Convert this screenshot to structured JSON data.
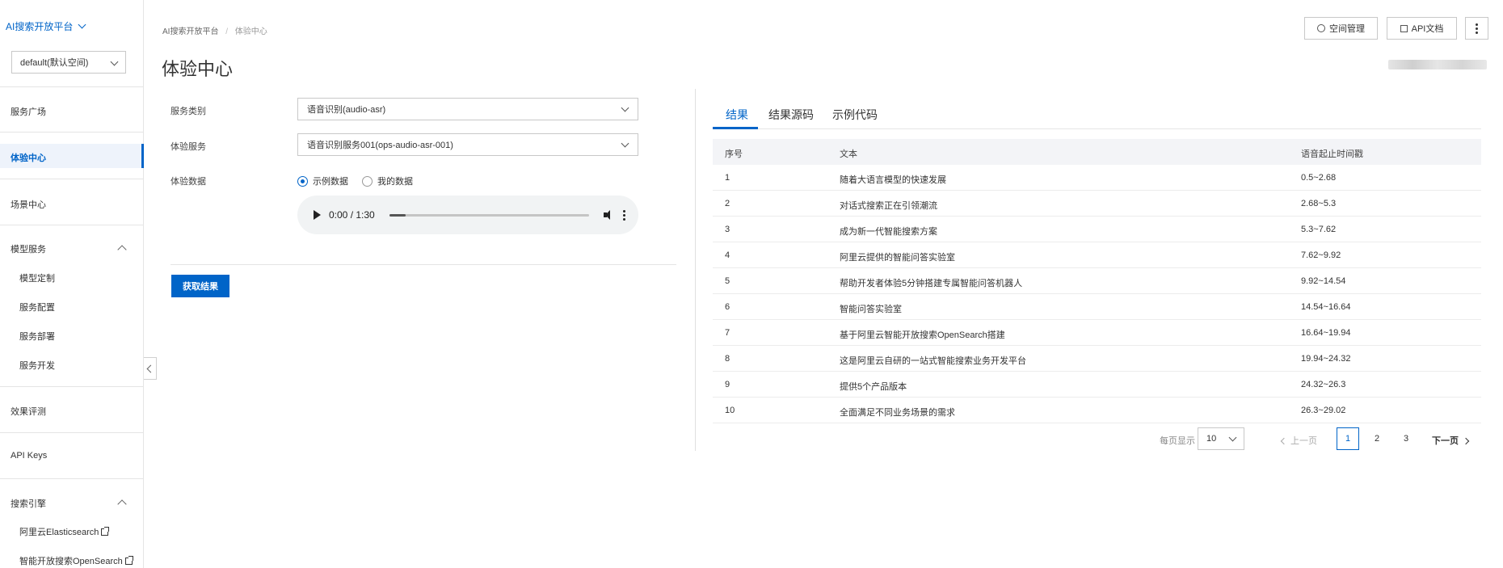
{
  "sidebar": {
    "brand": "AI搜索开放平台",
    "workspace": "default(默认空间)",
    "items": {
      "service_square": "服务广场",
      "experience_center": "体验中心",
      "scene_center": "场景中心",
      "model_service": "模型服务",
      "model_custom": "模型定制",
      "service_config": "服务配置",
      "service_deploy": "服务部署",
      "service_dev": "服务开发",
      "evaluation": "效果评测",
      "api_keys": "API Keys",
      "search_engine": "搜索引擎",
      "aliyun_es": "阿里云Elasticsearch",
      "opensearch": "智能开放搜索OpenSearch"
    }
  },
  "header": {
    "breadcrumb_root": "AI搜索开放平台",
    "breadcrumb_sep": "/",
    "breadcrumb_current": "体验中心",
    "title": "体验中心",
    "space_mgmt": "空间管理",
    "api_docs": "API文档"
  },
  "form": {
    "service_type_label": "服务类别",
    "service_type_value": "语音识别(audio-asr)",
    "service_label": "体验服务",
    "service_value": "语音识别服务001(ops-audio-asr-001)",
    "data_label": "体验数据",
    "radio_sample": "示例数据",
    "radio_mine": "我的数据",
    "audio_time": "0:00 / 1:30",
    "audio_progress": 0.0,
    "submit": "获取结果"
  },
  "results": {
    "tabs": [
      "结果",
      "结果源码",
      "示例代码"
    ],
    "columns": [
      "序号",
      "文本",
      "语音起止时间戳"
    ],
    "rows": [
      [
        "1",
        "随着大语言模型的快速发展",
        "0.5~2.68"
      ],
      [
        "2",
        "对话式搜索正在引领潮流",
        "2.68~5.3"
      ],
      [
        "3",
        "成为新一代智能搜索方案",
        "5.3~7.62"
      ],
      [
        "4",
        "阿里云提供的智能问答实验室",
        "7.62~9.92"
      ],
      [
        "5",
        "帮助开发者体验5分钟搭建专属智能问答机器人",
        "9.92~14.54"
      ],
      [
        "6",
        "智能问答实验室",
        "14.54~16.64"
      ],
      [
        "7",
        "基于阿里云智能开放搜索OpenSearch搭建",
        "16.64~19.94"
      ],
      [
        "8",
        "这是阿里云自研的一站式智能搜索业务开发平台",
        "19.94~24.32"
      ],
      [
        "9",
        "提供5个产品版本",
        "24.32~26.3"
      ],
      [
        "10",
        "全面满足不同业务场景的需求",
        "26.3~29.02"
      ]
    ]
  },
  "pagination": {
    "per_page_label": "每页显示",
    "per_page": "10",
    "prev": "上一页",
    "pages": [
      "1",
      "2",
      "3"
    ],
    "next": "下一页"
  },
  "colors": {
    "accent": "#0064c8"
  }
}
